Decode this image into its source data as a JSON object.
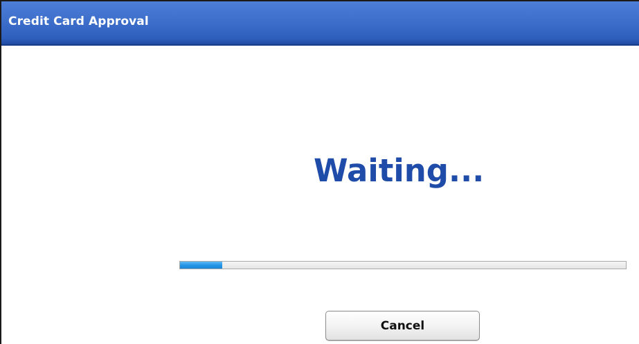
{
  "window": {
    "title": "Credit Card Approval"
  },
  "status": {
    "text": "Waiting..."
  },
  "progress": {
    "fraction": 0.095
  },
  "buttons": {
    "cancel_label": "Cancel"
  },
  "colors": {
    "title_bar": "#3d6fcb",
    "status_text": "#1f4ca8",
    "progress_fill": "#2596e6"
  }
}
